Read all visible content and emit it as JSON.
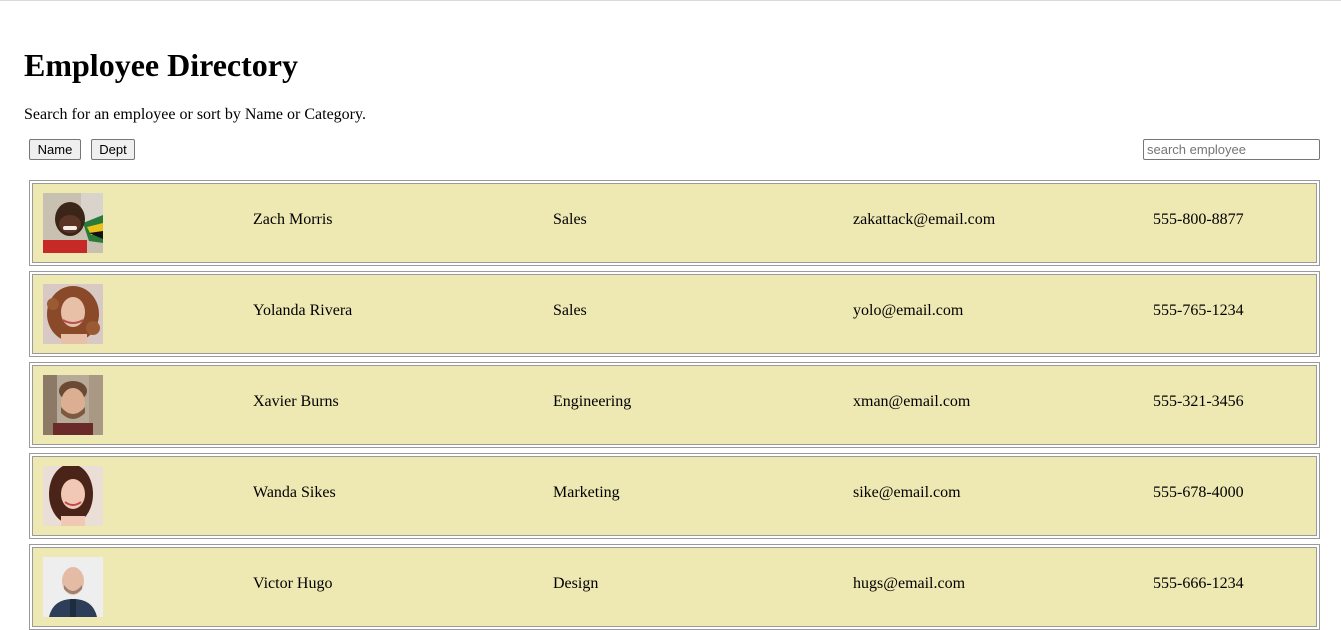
{
  "page": {
    "title": "Employee Directory",
    "subtitle": "Search for an employee or sort by Name or Category."
  },
  "controls": {
    "sort_name_label": "Name",
    "sort_dept_label": "Dept",
    "search_placeholder": "search employee",
    "search_value": ""
  },
  "employees": [
    {
      "name": "Zach Morris",
      "dept": "Sales",
      "email": "zakattack@email.com",
      "phone": "555-800-8877",
      "avatar_icon": "employee-photo"
    },
    {
      "name": "Yolanda Rivera",
      "dept": "Sales",
      "email": "yolo@email.com",
      "phone": "555-765-1234",
      "avatar_icon": "employee-photo"
    },
    {
      "name": "Xavier Burns",
      "dept": "Engineering",
      "email": "xman@email.com",
      "phone": "555-321-3456",
      "avatar_icon": "employee-photo"
    },
    {
      "name": "Wanda Sikes",
      "dept": "Marketing",
      "email": "sike@email.com",
      "phone": "555-678-4000",
      "avatar_icon": "employee-photo"
    },
    {
      "name": "Victor Hugo",
      "dept": "Design",
      "email": "hugs@email.com",
      "phone": "555-666-1234",
      "avatar_icon": "employee-photo"
    }
  ],
  "colors": {
    "row_background": "#eee8b3",
    "row_border": "#9a9a9a"
  }
}
